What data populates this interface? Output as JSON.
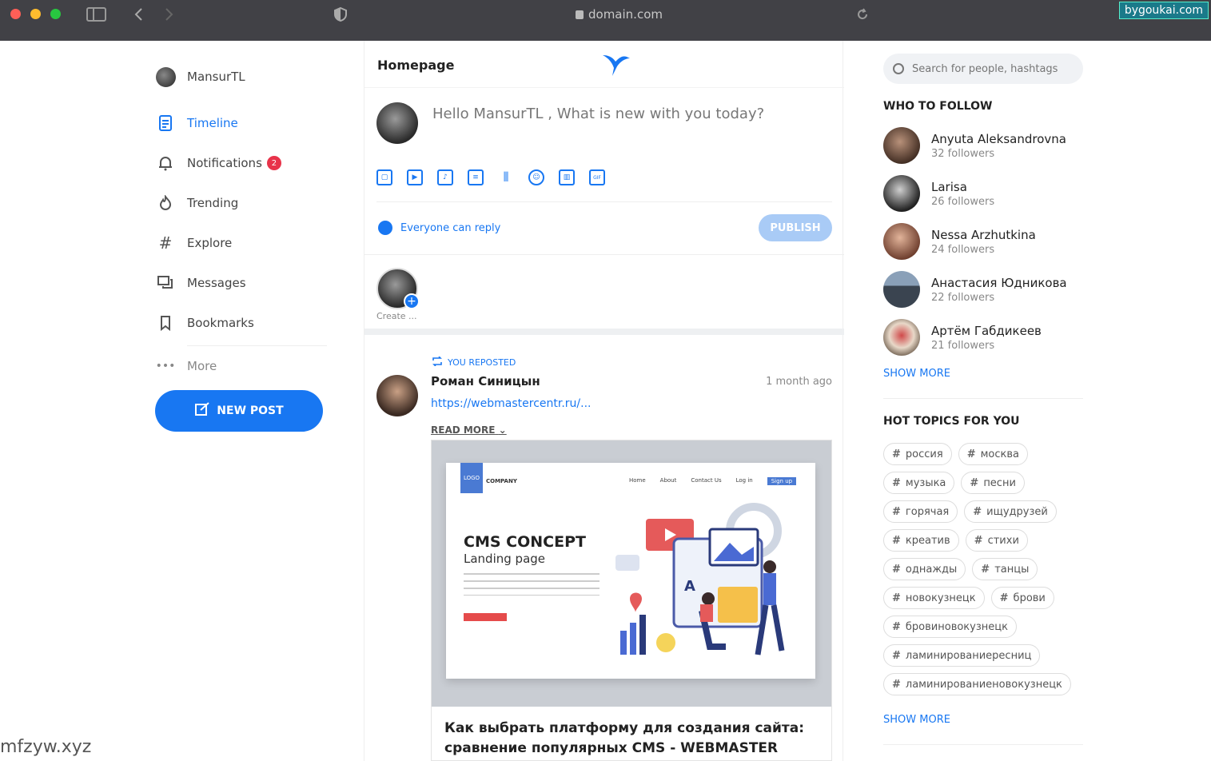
{
  "browser": {
    "url": "domain.com",
    "site_badge": "bygoukai.com"
  },
  "sidebar": {
    "profile_name": "MansurTL",
    "items": [
      {
        "label": "Timeline",
        "icon": "document-icon",
        "active": true
      },
      {
        "label": "Notifications",
        "icon": "bell-icon",
        "badge": "2"
      },
      {
        "label": "Trending",
        "icon": "fire-icon"
      },
      {
        "label": "Explore",
        "icon": "hashtag-icon"
      },
      {
        "label": "Messages",
        "icon": "chat-icon"
      },
      {
        "label": "Bookmarks",
        "icon": "bookmark-icon"
      }
    ],
    "more_label": "More",
    "new_post_label": "NEW POST"
  },
  "center": {
    "title": "Homepage",
    "compose_placeholder": "Hello MansurTL , What is new with you today?",
    "reply_setting": "Everyone can reply",
    "publish_label": "PUBLISH",
    "story_label": "Create ...",
    "post": {
      "repost_label": "YOU REPOSTED",
      "author": "Роман Синицын",
      "time": "1 month ago",
      "link": "https://webmastercentr.ru/...",
      "read_more": "READ MORE",
      "card": {
        "logo": "LOGO",
        "company": "COMPANY",
        "nav": [
          "Home",
          "About",
          "Contact Us",
          "Log in",
          "Sign up"
        ],
        "headline": "CMS CONCEPT",
        "subheadline": "Landing page",
        "title": "Как выбрать платформу для создания сайта: сравнение популярных CMS - WEBMASTER"
      }
    }
  },
  "right": {
    "search_placeholder": "Search for people, hashtags",
    "who_to_follow_title": "WHO TO FOLLOW",
    "follow": [
      {
        "name": "Anyuta Aleksandrovna",
        "followers": "32 followers",
        "color": "#6b4a3a"
      },
      {
        "name": "Larisa",
        "followers": "26 followers",
        "color": "#3a3a3a"
      },
      {
        "name": "Nessa Arzhutkina",
        "followers": "24 followers",
        "color": "#8a5a44"
      },
      {
        "name": "Анастасия Юдникова",
        "followers": "22 followers",
        "color": "#5a6470"
      },
      {
        "name": "Артём Габдикеев",
        "followers": "21 followers",
        "color": "#7a6a5a"
      }
    ],
    "show_more_1": "SHOW MORE",
    "hot_topics_title": "HOT TOPICS FOR YOU",
    "topics": [
      "россия",
      "москва",
      "музыка",
      "песни",
      "горячая",
      "ищудрузей",
      "креатив",
      "стихи",
      "однажды",
      "танцы",
      "новокузнецк",
      "брови",
      "бровиновокузнецк",
      "ламинированиересниц",
      "ламинированиеновокузнецк"
    ],
    "show_more_2": "SHOW MORE"
  },
  "watermark": "mfzyw.xyz",
  "colors": {
    "accent": "#1877f2",
    "badge": "#e8334a",
    "chrome": "#414146"
  }
}
